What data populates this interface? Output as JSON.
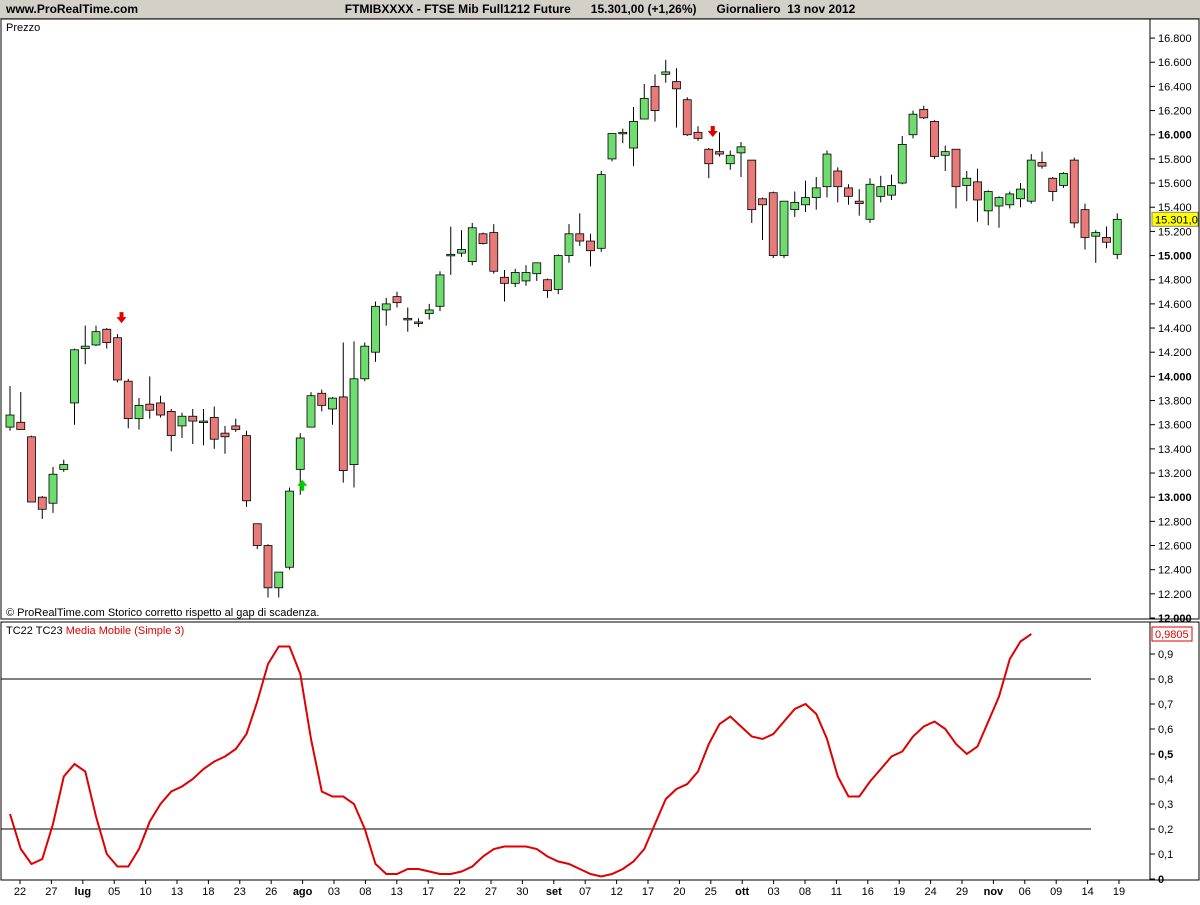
{
  "header": {
    "site": "www.ProRealTime.com",
    "title": "FTMIBXXXX - FTSE Mib Full1212 Future      15.301,00 (+1,26%)      Giornaliero  13 nov 2012"
  },
  "price_panel": {
    "label": "Prezzo",
    "footnote": "© ProRealTime.com  Storico corretto rispetto al gap di scadenza.",
    "last_value_label": "15.301,0",
    "y_ticks": [
      "16.800",
      "16.600",
      "16.400",
      "16.200",
      "16.000",
      "15.800",
      "15.600",
      "15.400",
      "15.200",
      "15.000",
      "14.800",
      "14.600",
      "14.400",
      "14.200",
      "14.000",
      "13.800",
      "13.600",
      "13.400",
      "13.200",
      "13.000",
      "12.800",
      "12.600",
      "12.400",
      "12.200",
      "12.000"
    ]
  },
  "indicator_panel": {
    "label_prefix": "TC22 TC23 ",
    "label_ma": "Media Mobile (Simple 3)",
    "last_value_label": "0,9805",
    "y_ticks": [
      "0,9",
      "0,8",
      "0,7",
      "0,6",
      "0,5",
      "0,4",
      "0,3",
      "0,2",
      "0,1",
      "0"
    ]
  },
  "x_axis": {
    "ticks": [
      "22",
      "27",
      "lug",
      "05",
      "10",
      "13",
      "18",
      "23",
      "26",
      "ago",
      "03",
      "08",
      "13",
      "17",
      "22",
      "27",
      "30",
      "set",
      "07",
      "12",
      "17",
      "20",
      "25",
      "ott",
      "03",
      "08",
      "11",
      "16",
      "19",
      "24",
      "29",
      "nov",
      "06",
      "09",
      "14",
      "19"
    ]
  },
  "colors": {
    "up": "#6fdc6f",
    "down": "#e87a7a",
    "ma_line": "#e00000",
    "arrow_down": "#e00000",
    "arrow_up": "#00cc00",
    "last_value_bg": "#ffff00",
    "panel_header": "#d4d0c8"
  },
  "chart_data": [
    {
      "type": "candlestick",
      "title": "FTMIBXXXX - FTSE Mib Full1212 Future",
      "ylabel": "Prezzo",
      "ylim": [
        12000,
        16900
      ],
      "candles": [
        {
          "o": 13580,
          "h": 13920,
          "l": 13550,
          "c": 13680
        },
        {
          "o": 13620,
          "h": 13870,
          "l": 13560,
          "c": 13560
        },
        {
          "o": 13500,
          "h": 13510,
          "l": 12960,
          "c": 12960
        },
        {
          "o": 13000,
          "h": 13010,
          "l": 12820,
          "c": 12900
        },
        {
          "o": 12950,
          "h": 13250,
          "l": 12870,
          "c": 13190
        },
        {
          "o": 13230,
          "h": 13310,
          "l": 13210,
          "c": 13270
        },
        {
          "o": 13780,
          "h": 14230,
          "l": 13600,
          "c": 14220
        },
        {
          "o": 14230,
          "h": 14420,
          "l": 14100,
          "c": 14250
        },
        {
          "o": 14260,
          "h": 14420,
          "l": 14250,
          "c": 14370
        },
        {
          "o": 14390,
          "h": 14400,
          "l": 14230,
          "c": 14280
        },
        {
          "o": 14320,
          "h": 14350,
          "l": 13950,
          "c": 13970
        },
        {
          "o": 13960,
          "h": 13980,
          "l": 13570,
          "c": 13650
        },
        {
          "o": 13650,
          "h": 13820,
          "l": 13560,
          "c": 13760
        },
        {
          "o": 13770,
          "h": 14000,
          "l": 13650,
          "c": 13720
        },
        {
          "o": 13780,
          "h": 13840,
          "l": 13660,
          "c": 13680
        },
        {
          "o": 13710,
          "h": 13730,
          "l": 13380,
          "c": 13510
        },
        {
          "o": 13590,
          "h": 13700,
          "l": 13490,
          "c": 13670
        },
        {
          "o": 13670,
          "h": 13730,
          "l": 13440,
          "c": 13630
        },
        {
          "o": 13630,
          "h": 13730,
          "l": 13430,
          "c": 13630
        },
        {
          "o": 13660,
          "h": 13750,
          "l": 13400,
          "c": 13480
        },
        {
          "o": 13530,
          "h": 13590,
          "l": 13360,
          "c": 13500
        },
        {
          "o": 13590,
          "h": 13650,
          "l": 13540,
          "c": 13560
        },
        {
          "o": 13510,
          "h": 13550,
          "l": 12920,
          "c": 12970
        },
        {
          "o": 12780,
          "h": 12780,
          "l": 12570,
          "c": 12600
        },
        {
          "o": 12600,
          "h": 12610,
          "l": 12170,
          "c": 12250
        },
        {
          "o": 12250,
          "h": 12370,
          "l": 12170,
          "c": 12380
        },
        {
          "o": 12420,
          "h": 13080,
          "l": 12400,
          "c": 13050
        },
        {
          "o": 13230,
          "h": 13530,
          "l": 13020,
          "c": 13490
        },
        {
          "o": 13580,
          "h": 13870,
          "l": 13580,
          "c": 13840
        },
        {
          "o": 13860,
          "h": 13890,
          "l": 13710,
          "c": 13760
        },
        {
          "o": 13730,
          "h": 13830,
          "l": 13600,
          "c": 13820
        },
        {
          "o": 13830,
          "h": 14280,
          "l": 13120,
          "c": 13220
        },
        {
          "o": 13270,
          "h": 14290,
          "l": 13080,
          "c": 13980
        },
        {
          "o": 13980,
          "h": 14280,
          "l": 13960,
          "c": 14250
        },
        {
          "o": 14200,
          "h": 14620,
          "l": 14120,
          "c": 14580
        },
        {
          "o": 14550,
          "h": 14650,
          "l": 14420,
          "c": 14600
        },
        {
          "o": 14660,
          "h": 14700,
          "l": 14570,
          "c": 14610
        },
        {
          "o": 14480,
          "h": 14570,
          "l": 14370,
          "c": 14480
        },
        {
          "o": 14440,
          "h": 14480,
          "l": 14410,
          "c": 14450
        },
        {
          "o": 14520,
          "h": 14600,
          "l": 14470,
          "c": 14550
        },
        {
          "o": 14580,
          "h": 14870,
          "l": 14540,
          "c": 14840
        },
        {
          "o": 15000,
          "h": 15240,
          "l": 14840,
          "c": 15010
        },
        {
          "o": 15020,
          "h": 15210,
          "l": 14990,
          "c": 15050
        },
        {
          "o": 14950,
          "h": 15270,
          "l": 14920,
          "c": 15230
        },
        {
          "o": 15180,
          "h": 15190,
          "l": 15090,
          "c": 15100
        },
        {
          "o": 15190,
          "h": 15260,
          "l": 14850,
          "c": 14870
        },
        {
          "o": 14820,
          "h": 14880,
          "l": 14620,
          "c": 14770
        },
        {
          "o": 14770,
          "h": 14890,
          "l": 14740,
          "c": 14860
        },
        {
          "o": 14790,
          "h": 14920,
          "l": 14750,
          "c": 14860
        },
        {
          "o": 14850,
          "h": 14940,
          "l": 14790,
          "c": 14940
        },
        {
          "o": 14800,
          "h": 14810,
          "l": 14650,
          "c": 14710
        },
        {
          "o": 14720,
          "h": 15010,
          "l": 14680,
          "c": 15000
        },
        {
          "o": 15000,
          "h": 15260,
          "l": 14940,
          "c": 15180
        },
        {
          "o": 15180,
          "h": 15350,
          "l": 15080,
          "c": 15120
        },
        {
          "o": 15120,
          "h": 15180,
          "l": 14910,
          "c": 15040
        },
        {
          "o": 15060,
          "h": 15700,
          "l": 15030,
          "c": 15670
        },
        {
          "o": 15800,
          "h": 16000,
          "l": 15780,
          "c": 16010
        },
        {
          "o": 16020,
          "h": 16050,
          "l": 15930,
          "c": 16020
        },
        {
          "o": 15890,
          "h": 16230,
          "l": 15740,
          "c": 16110
        },
        {
          "o": 16130,
          "h": 16420,
          "l": 16130,
          "c": 16300
        },
        {
          "o": 16400,
          "h": 16500,
          "l": 16110,
          "c": 16200
        },
        {
          "o": 16500,
          "h": 16620,
          "l": 16430,
          "c": 16520
        },
        {
          "o": 16440,
          "h": 16550,
          "l": 16060,
          "c": 16380
        },
        {
          "o": 16290,
          "h": 16310,
          "l": 15990,
          "c": 16000
        },
        {
          "o": 16020,
          "h": 16070,
          "l": 15950,
          "c": 15970
        },
        {
          "o": 15880,
          "h": 15890,
          "l": 15640,
          "c": 15760
        },
        {
          "o": 15860,
          "h": 16020,
          "l": 15820,
          "c": 15840
        },
        {
          "o": 15760,
          "h": 15870,
          "l": 15710,
          "c": 15830
        },
        {
          "o": 15850,
          "h": 15940,
          "l": 15650,
          "c": 15900
        },
        {
          "o": 15790,
          "h": 15790,
          "l": 15270,
          "c": 15380
        },
        {
          "o": 15470,
          "h": 15480,
          "l": 15130,
          "c": 15420
        },
        {
          "o": 15520,
          "h": 15530,
          "l": 14980,
          "c": 15000
        },
        {
          "o": 15000,
          "h": 15440,
          "l": 14980,
          "c": 15450
        },
        {
          "o": 15380,
          "h": 15530,
          "l": 15320,
          "c": 15440
        },
        {
          "o": 15420,
          "h": 15620,
          "l": 15360,
          "c": 15480
        },
        {
          "o": 15480,
          "h": 15650,
          "l": 15380,
          "c": 15560
        },
        {
          "o": 15570,
          "h": 15870,
          "l": 15480,
          "c": 15840
        },
        {
          "o": 15700,
          "h": 15730,
          "l": 15440,
          "c": 15570
        },
        {
          "o": 15560,
          "h": 15590,
          "l": 15420,
          "c": 15490
        },
        {
          "o": 15450,
          "h": 15550,
          "l": 15330,
          "c": 15430
        },
        {
          "o": 15300,
          "h": 15640,
          "l": 15270,
          "c": 15590
        },
        {
          "o": 15490,
          "h": 15660,
          "l": 15440,
          "c": 15570
        },
        {
          "o": 15500,
          "h": 15670,
          "l": 15460,
          "c": 15580
        },
        {
          "o": 15600,
          "h": 15990,
          "l": 15590,
          "c": 15920
        },
        {
          "o": 16000,
          "h": 16200,
          "l": 15970,
          "c": 16170
        },
        {
          "o": 16210,
          "h": 16240,
          "l": 16130,
          "c": 16140
        },
        {
          "o": 16110,
          "h": 16120,
          "l": 15800,
          "c": 15820
        },
        {
          "o": 15830,
          "h": 15910,
          "l": 15700,
          "c": 15860
        },
        {
          "o": 15880,
          "h": 15880,
          "l": 15390,
          "c": 15570
        },
        {
          "o": 15580,
          "h": 15700,
          "l": 15450,
          "c": 15640
        },
        {
          "o": 15610,
          "h": 15720,
          "l": 15280,
          "c": 15460
        },
        {
          "o": 15370,
          "h": 15540,
          "l": 15250,
          "c": 15530
        },
        {
          "o": 15410,
          "h": 15490,
          "l": 15230,
          "c": 15480
        },
        {
          "o": 15420,
          "h": 15530,
          "l": 15390,
          "c": 15510
        },
        {
          "o": 15470,
          "h": 15600,
          "l": 15400,
          "c": 15550
        },
        {
          "o": 15450,
          "h": 15840,
          "l": 15430,
          "c": 15790
        },
        {
          "o": 15770,
          "h": 15860,
          "l": 15720,
          "c": 15740
        },
        {
          "o": 15640,
          "h": 15650,
          "l": 15450,
          "c": 15530
        },
        {
          "o": 15580,
          "h": 15690,
          "l": 15560,
          "c": 15680
        },
        {
          "o": 15790,
          "h": 15810,
          "l": 15230,
          "c": 15270
        },
        {
          "o": 15380,
          "h": 15430,
          "l": 15050,
          "c": 15150
        },
        {
          "o": 15160,
          "h": 15210,
          "l": 14940,
          "c": 15190
        },
        {
          "o": 15150,
          "h": 15240,
          "l": 15060,
          "c": 15110
        },
        {
          "o": 15010,
          "h": 15350,
          "l": 14970,
          "c": 15300
        }
      ],
      "arrows_down_after_index": [
        10,
        65
      ],
      "arrows_up_below_index": [
        27
      ]
    },
    {
      "type": "line",
      "title": "Media Mobile (Simple 3)",
      "ylim": [
        0,
        1.02
      ],
      "reference_lines": [
        0.2,
        0.8
      ],
      "series": [
        {
          "name": "Media Mobile (Simple 3)",
          "values": [
            0.26,
            0.12,
            0.06,
            0.08,
            0.22,
            0.41,
            0.46,
            0.43,
            0.25,
            0.1,
            0.05,
            0.05,
            0.12,
            0.23,
            0.3,
            0.35,
            0.37,
            0.4,
            0.44,
            0.47,
            0.49,
            0.52,
            0.58,
            0.71,
            0.86,
            0.93,
            0.93,
            0.82,
            0.56,
            0.35,
            0.33,
            0.33,
            0.3,
            0.2,
            0.06,
            0.02,
            0.02,
            0.04,
            0.04,
            0.03,
            0.02,
            0.02,
            0.03,
            0.05,
            0.09,
            0.12,
            0.13,
            0.13,
            0.13,
            0.12,
            0.09,
            0.07,
            0.06,
            0.04,
            0.02,
            0.01,
            0.02,
            0.04,
            0.07,
            0.12,
            0.22,
            0.32,
            0.36,
            0.38,
            0.43,
            0.54,
            0.62,
            0.65,
            0.61,
            0.57,
            0.56,
            0.58,
            0.63,
            0.68,
            0.7,
            0.66,
            0.56,
            0.41,
            0.33,
            0.33,
            0.39,
            0.44,
            0.49,
            0.51,
            0.57,
            0.61,
            0.63,
            0.6,
            0.54,
            0.5,
            0.53,
            0.63,
            0.73,
            0.88,
            0.95,
            0.98
          ]
        }
      ]
    }
  ]
}
